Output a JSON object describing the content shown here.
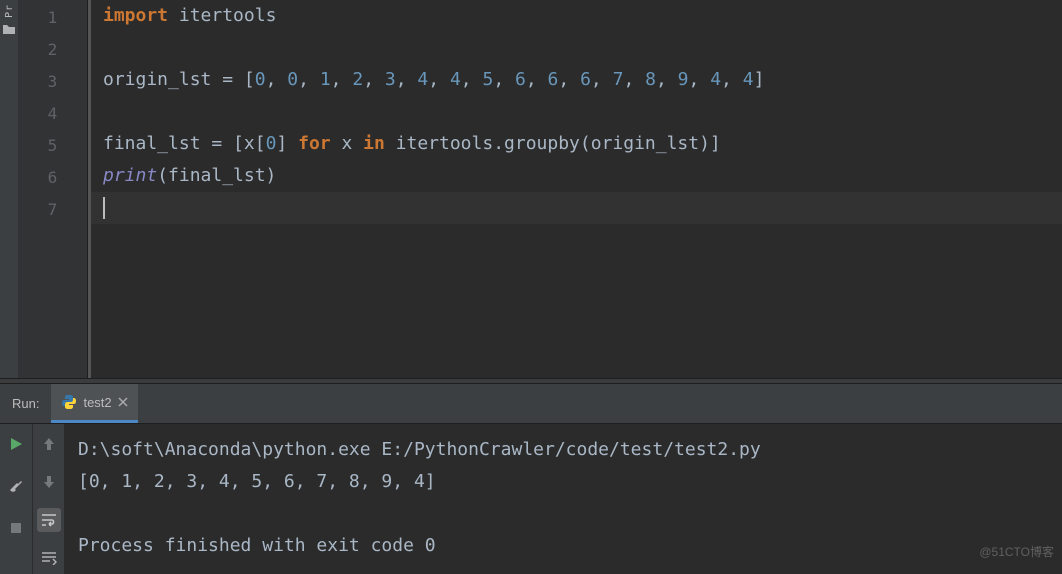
{
  "sidebar": {
    "project_label": "Pr"
  },
  "editor": {
    "line_count": 7,
    "tokens": {
      "l1": {
        "t1": "import",
        "t2": " itertools"
      },
      "l3": {
        "t1": "origin_lst ",
        "op": "=",
        "t2": " [",
        "nums": [
          "0",
          "0",
          "1",
          "2",
          "3",
          "4",
          "4",
          "5",
          "6",
          "6",
          "6",
          "7",
          "8",
          "9",
          "4",
          "4"
        ],
        "t3": "]"
      },
      "l5": {
        "t1": "final_lst ",
        "op": "=",
        "t2": " [x[",
        "z": "0",
        "t3": "] ",
        "for": "for",
        "t4": " x ",
        "in": "in",
        "t5": " itertools.groupby(origin_lst)]"
      },
      "l6": {
        "t1": "print",
        "t2": "(final_lst)"
      }
    }
  },
  "run": {
    "panel_label": "Run:",
    "tab_name": "test2",
    "output": {
      "cmd": "D:\\soft\\Anaconda\\python.exe E:/PythonCrawler/code/test/test2.py",
      "result": "[0, 1, 2, 3, 4, 5, 6, 7, 8, 9, 4]",
      "exitmsg": "Process finished with exit code 0"
    }
  },
  "icons": {
    "python": "python-icon",
    "play": "play-icon",
    "wrench": "wrench-icon",
    "stop": "stop-icon",
    "up": "up-arrow-icon",
    "down": "down-arrow-icon",
    "wrap": "wrap-icon",
    "scroll": "scroll-icon",
    "folder": "folder-icon"
  },
  "watermark": "@51CTO博客"
}
